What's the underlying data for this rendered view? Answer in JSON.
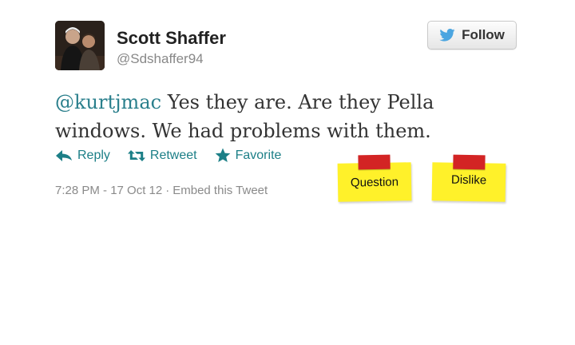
{
  "tweet": {
    "display_name": "Scott Shaffer",
    "handle": "@Sdshaffer94",
    "follow_label": "Follow",
    "mention": "@kurtjmac",
    "text_line1": " Yes they are. Are they Pella",
    "text_line2": "windows. We had problems with them.",
    "timestamp": "7:28 PM - 17 Oct 12",
    "separator": "·",
    "embed_label": "Embed this Tweet"
  },
  "actions": {
    "reply": "Reply",
    "retweet": "Retweet",
    "favorite": "Favorite"
  },
  "stickers": {
    "question": "Question",
    "dislike": "Dislike"
  },
  "colors": {
    "link": "#2a7f8c",
    "action": "#1c7f87",
    "twitter_bird": "#4ba5e0",
    "sticky_note": "#fff12a",
    "tape": "#d32424"
  },
  "icons": {
    "reply": "reply-arrow-icon",
    "retweet": "retweet-icon",
    "favorite": "star-icon",
    "follow": "twitter-bird-icon"
  }
}
